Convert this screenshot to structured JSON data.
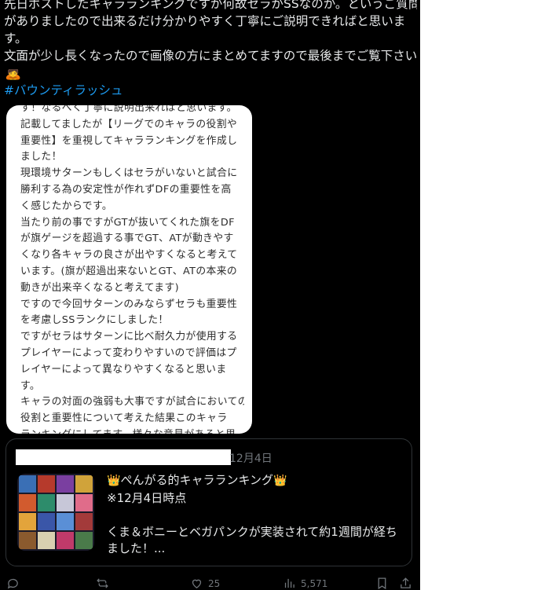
{
  "post": {
    "text_lines": [
      "先日ポストしたキャラランキングですが何故セラがSSなのか。というご質問",
      "がありましたので出来るだけ分かりやすく丁寧にご説明できればと思いま",
      "す。",
      "文面が少し長くなったので画像の方にまとめてますので最後までご覧下さい"
    ],
    "emoji": "🙇",
    "hashtag": "#バウンティラッシュ"
  },
  "document_image": {
    "lines": [
      "す！なるべく丁寧に説明出来ればと思います。",
      "記載してましたが【リーグでのキャラの役割や",
      "重要性】を重視してキャラランキングを作成し",
      "ました！",
      "現環境サターンもしくはセラがいないと試合に",
      "勝利する為の安定性が作れずDFの重要性を高",
      "く感じたからです。",
      "当たり前の事ですがGTが抜いてくれた旗をDF",
      "が旗ゲージを超過する事でGT、ATが動きやす",
      "くなり各キャラの良さが出やすくなると考えて",
      "います。(旗が超過出来ないとGT、ATの本来の",
      "動きが出来辛くなると考えてます)",
      "ですので今回サターンのみならずセラも重要性",
      "を考慮しSSランクにしました！",
      "ですがセラはサターンに比べ耐久力が使用する",
      "プレイヤーによって変わりやすいので評価はプ",
      "レイヤーによって異なりやすくなると思いま",
      "す。",
      "キャラの対面の強弱も大事ですが試合においての",
      "役割と重要性について考えた結果このキャラ",
      "ランキングにしてます。様々な意見があると思"
    ]
  },
  "quote": {
    "date": "12月4日",
    "crown_emoji": "👑",
    "title": "ぺんがる的キャラランキング",
    "line2": "※12月4日時点",
    "line3": "くま＆ボニーとベガパンクが実装されて約1週間が経ち",
    "line4": "ました！..."
  },
  "actions": {
    "reply_count": "",
    "retweet_count": "",
    "like_count": "25",
    "views_count": "5,571"
  },
  "colors": {
    "background": "#000000",
    "text": "#e7e9ea",
    "link": "#1d9bf0",
    "muted": "#71767b",
    "border": "#2f3336"
  }
}
